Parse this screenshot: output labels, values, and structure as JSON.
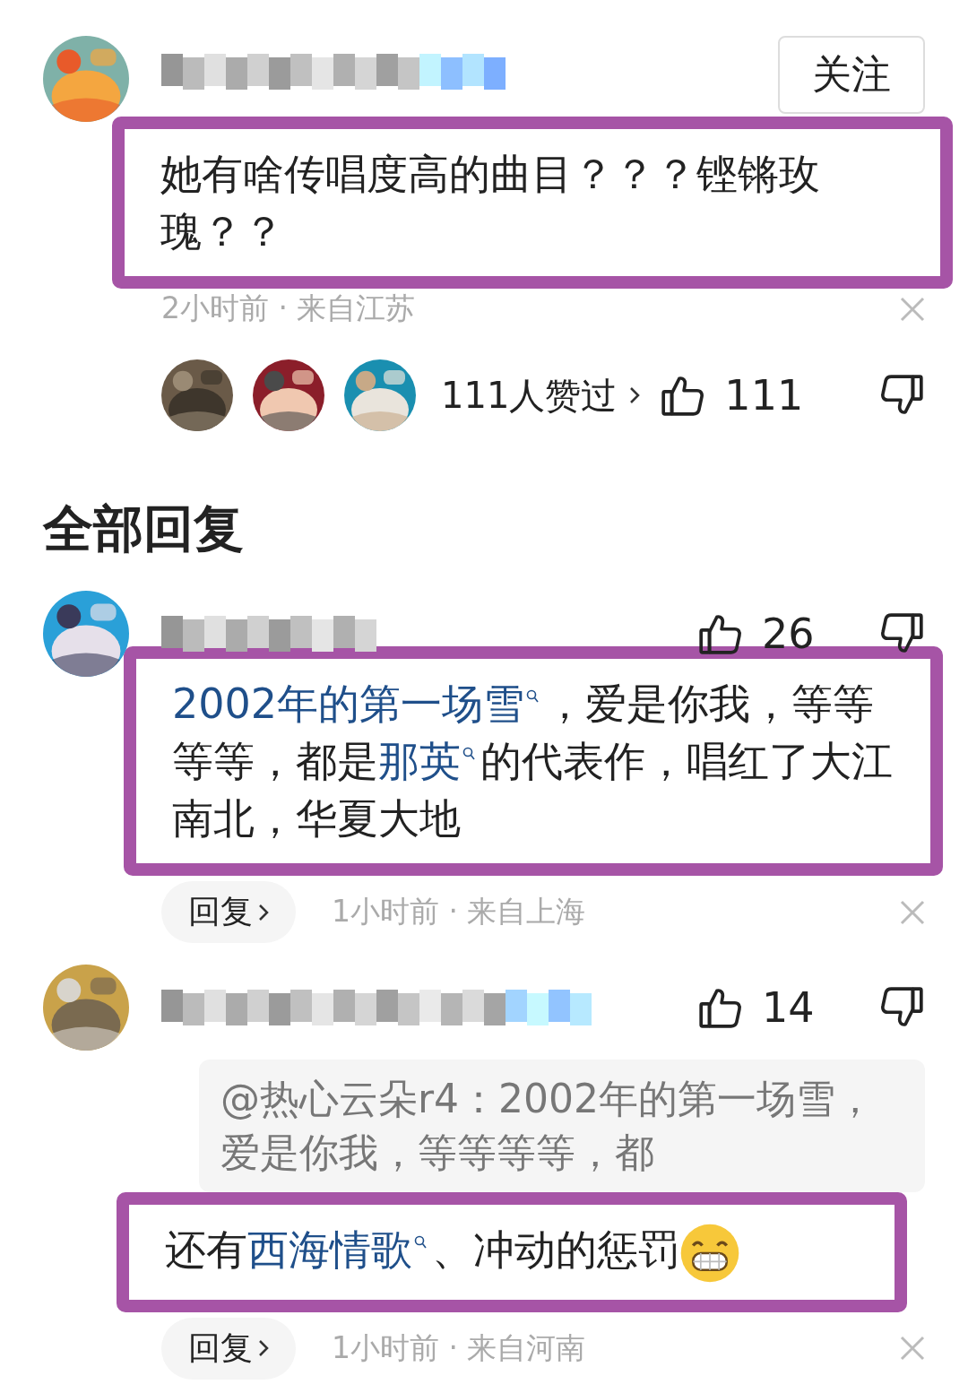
{
  "comment": {
    "follow_button": "关注",
    "text": "她有啥传唱度高的曲目？？？铿锵玫瑰？？",
    "highlighted": true,
    "meta": "2小时前 · 来自江苏",
    "likers_label": "111人赞过",
    "likes": "111"
  },
  "replies_heading": "全部回复",
  "replies": [
    {
      "likes": "26",
      "highlighted": true,
      "segments": [
        {
          "kind": "link",
          "text": "2002年的第一场雪"
        },
        {
          "kind": "text",
          "text": "，爱是你我，等等等等，都是"
        },
        {
          "kind": "link",
          "text": "那英"
        },
        {
          "kind": "text",
          "text": "的代表作，唱红了大江南北，华夏大地"
        }
      ],
      "reply_button": "回复",
      "meta": "1小时前 · 来自上海"
    },
    {
      "likes": "14",
      "highlighted": true,
      "quote": "@热心云朵r4：2002年的第一场雪，爱是你我，等等等等，都",
      "segments": [
        {
          "kind": "text",
          "text": "还有"
        },
        {
          "kind": "link",
          "text": "西海情歌"
        },
        {
          "kind": "text",
          "text": "、冲动的惩罚"
        },
        {
          "kind": "emoji"
        }
      ],
      "reply_button": "回复",
      "meta": "1小时前 · 来自河南"
    }
  ]
}
